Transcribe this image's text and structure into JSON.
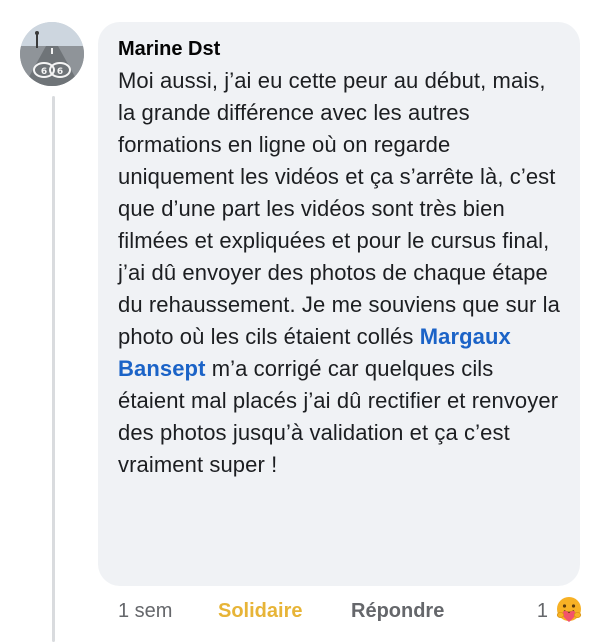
{
  "comment": {
    "author": "Marine Dst",
    "text_before_mention": "Moi aussi, j’ai eu cette peur au début, mais, la grande différence avec les autres formations en ligne où on regarde uniquement les vidéos et ça s’arrête là, c’est que d’une part les vidéos sont très bien filmées et expliquées et pour le cursus final, j’ai dû envoyer des photos de chaque étape du rehaussement.  Je me souviens que sur la photo où les cils étaient collés ",
    "mention": "Margaux Bansept",
    "text_after_mention": " m’a corrigé car quelques cils étaient mal placés j’ai dû rectifier et renvoyer des photos jusqu’à validation et ça c’est vraiment super !"
  },
  "actions": {
    "time": "1 sem",
    "reaction_label": "Solidaire",
    "reply_label": "Répondre",
    "reaction_count": "1"
  },
  "icons": {
    "reaction": "care-emoji-icon",
    "avatar_badge": "route-66-sign"
  },
  "colors": {
    "mention": "#1b63c7",
    "reaction_label": "#e7b437",
    "bubble": "#f0f2f5"
  }
}
